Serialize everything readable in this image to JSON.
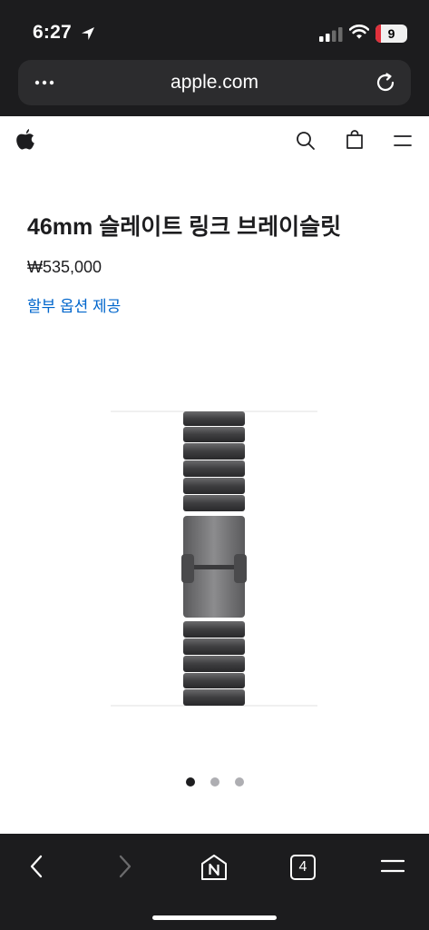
{
  "status_bar": {
    "time": "6:27",
    "battery_level": "9",
    "icons": [
      "location-arrow-icon",
      "signal-icon",
      "wifi-icon",
      "battery-icon"
    ]
  },
  "browser": {
    "url": "apple.com",
    "icons": [
      "more-icon",
      "reload-icon"
    ]
  },
  "site_nav": {
    "icons": [
      "apple-logo-icon",
      "search-icon",
      "bag-icon",
      "menu-icon"
    ]
  },
  "product": {
    "title": "46mm 슬레이트 링크 브레이슬릿",
    "price": "₩535,000",
    "installment_link": "할부 옵션 제공",
    "carousel": {
      "total": 3,
      "active": 1
    }
  },
  "toolbar": {
    "tab_count": "4",
    "icons": [
      "back-icon",
      "forward-icon",
      "naver-home-icon",
      "tabs-icon",
      "menu-icon"
    ]
  },
  "colors": {
    "chrome_bg": "#1c1c1e",
    "url_bar_bg": "#2c2c2e",
    "link": "#0066cc",
    "text": "#1d1d1f",
    "battery_low": "#e0303b"
  }
}
